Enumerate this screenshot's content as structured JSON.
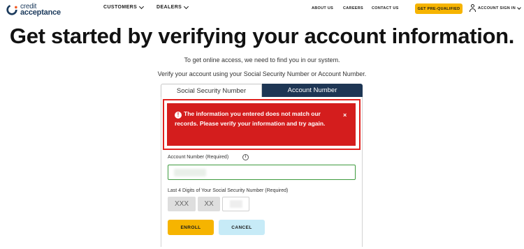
{
  "header": {
    "logo_line1": "credit",
    "logo_line2": "acceptance",
    "nav": {
      "customers": "CUSTOMERS",
      "dealers": "DEALERS",
      "about": "ABOUT US",
      "careers": "CAREERS",
      "contact": "CONTACT US",
      "prequal": "GET PRE-QUALIFIED",
      "signin": "ACCOUNT SIGN IN"
    }
  },
  "main": {
    "headline": "Get started by verifying your account information.",
    "subtitle1": "To get online access, we need to find you in our system.",
    "subtitle2": "Verify your account using your Social Security Number or Account Number.",
    "tabs": {
      "ssn": "Social Security Number",
      "account": "Account Number",
      "active": "account"
    },
    "error": {
      "message": "The information you entered does not match our records. Please verify your information and try again.",
      "icon": "exclamation-circle-icon",
      "close": "×"
    },
    "account_field": {
      "label": "Account Number (Required)",
      "value": ""
    },
    "ssn_field": {
      "label": "Last 4 Digits of Your Social Security Number (Required)",
      "part1": "XXX",
      "part2": "XX",
      "part3": ""
    },
    "buttons": {
      "enroll": "ENROLL",
      "cancel": "CANCEL"
    }
  },
  "colors": {
    "brand_navy": "#1e3654",
    "accent_yellow": "#f6b400",
    "error_red": "#d41d1d",
    "cancel_blue": "#c7ebf7",
    "valid_green": "#3e9b3e"
  }
}
